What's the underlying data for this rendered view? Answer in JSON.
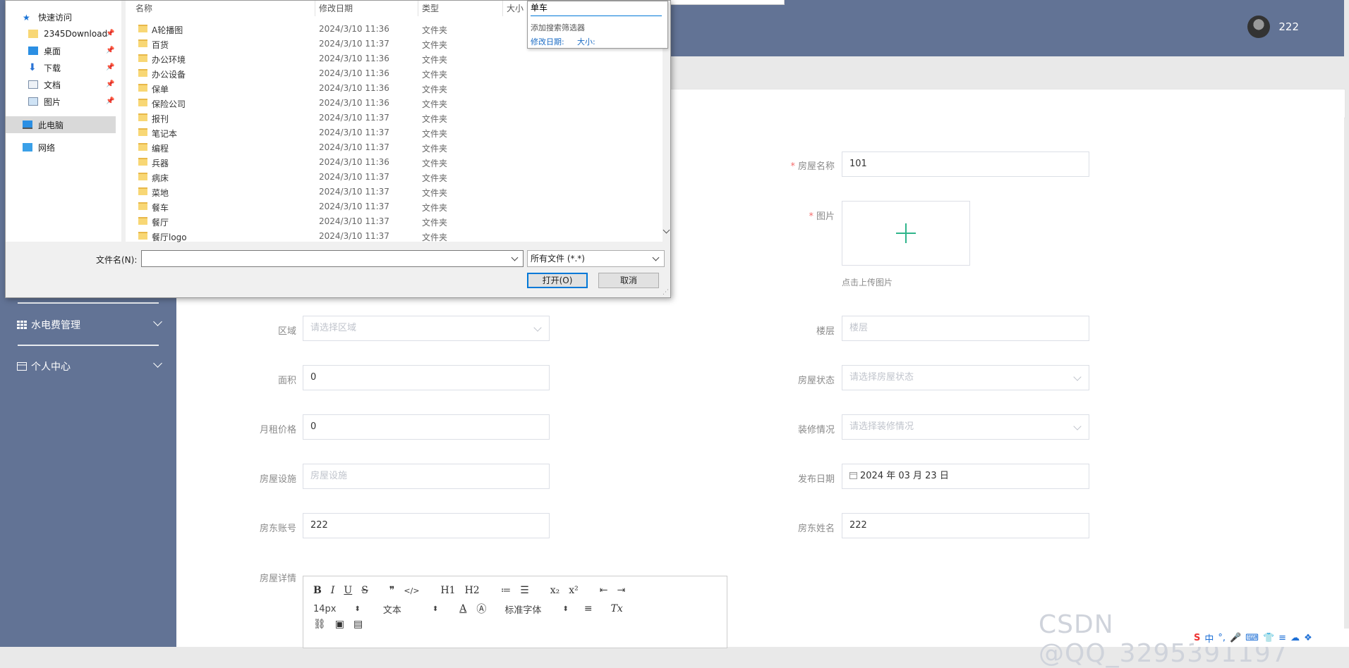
{
  "header": {
    "username": "222"
  },
  "sidebar": {
    "items": [
      {
        "label": "水电费管理"
      },
      {
        "label": "个人中心"
      }
    ]
  },
  "form": {
    "house_name": {
      "label": "房屋名称",
      "value": "101"
    },
    "image": {
      "label": "图片",
      "hint": "点击上传图片"
    },
    "region": {
      "label": "区域",
      "placeholder": "请选择区域"
    },
    "floor": {
      "label": "楼层",
      "placeholder": "楼层"
    },
    "area": {
      "label": "面积",
      "value": "0"
    },
    "house_status": {
      "label": "房屋状态",
      "placeholder": "请选择房屋状态"
    },
    "rent": {
      "label": "月租价格",
      "value": "0"
    },
    "decoration": {
      "label": "装修情况",
      "placeholder": "请选择装修情况"
    },
    "facilities": {
      "label": "房屋设施",
      "placeholder": "房屋设施"
    },
    "publish_date": {
      "label": "发布日期",
      "value": "2024 年 03 月 23 日"
    },
    "landlord_account": {
      "label": "房东账号",
      "value": "222"
    },
    "landlord_name": {
      "label": "房东姓名",
      "value": "222"
    },
    "details": {
      "label": "房屋详情"
    }
  },
  "editor": {
    "row1": [
      "B",
      "I",
      "U",
      "S",
      "❞",
      "</>",
      "H1",
      "H2",
      "≔",
      "☰",
      "x₂",
      "x²",
      "⇤",
      "⇥"
    ],
    "row2": {
      "size": "14px",
      "format": "文本",
      "font": "标准字体"
    },
    "row2_icons": [
      "A",
      "Ⓐ",
      "≡",
      "Tx"
    ],
    "row3": [
      "⛓",
      "▣",
      "▤"
    ]
  },
  "watermark": "CSDN @QQ_3295391197",
  "tray": [
    "中",
    "°,",
    "🎤",
    "⌨",
    "👕",
    "≡",
    "☁",
    "❖"
  ],
  "file_dialog": {
    "nav": {
      "quick_access": "快速访问",
      "items": [
        "2345Download",
        "桌面",
        "下载",
        "文档",
        "图片"
      ],
      "this_pc": "此电脑",
      "network": "网络"
    },
    "columns": {
      "name": "名称",
      "modified": "修改日期",
      "type": "类型",
      "size": "大小"
    },
    "rows": [
      {
        "name": "A轮播图",
        "date": "2024/3/10 11:36",
        "type": "文件夹"
      },
      {
        "name": "百货",
        "date": "2024/3/10 11:37",
        "type": "文件夹"
      },
      {
        "name": "办公环境",
        "date": "2024/3/10 11:36",
        "type": "文件夹"
      },
      {
        "name": "办公设备",
        "date": "2024/3/10 11:36",
        "type": "文件夹"
      },
      {
        "name": "保单",
        "date": "2024/3/10 11:36",
        "type": "文件夹"
      },
      {
        "name": "保险公司",
        "date": "2024/3/10 11:36",
        "type": "文件夹"
      },
      {
        "name": "报刊",
        "date": "2024/3/10 11:37",
        "type": "文件夹"
      },
      {
        "name": "笔记本",
        "date": "2024/3/10 11:37",
        "type": "文件夹"
      },
      {
        "name": "编程",
        "date": "2024/3/10 11:37",
        "type": "文件夹"
      },
      {
        "name": "兵器",
        "date": "2024/3/10 11:36",
        "type": "文件夹"
      },
      {
        "name": "病床",
        "date": "2024/3/10 11:37",
        "type": "文件夹"
      },
      {
        "name": "菜地",
        "date": "2024/3/10 11:37",
        "type": "文件夹"
      },
      {
        "name": "餐车",
        "date": "2024/3/10 11:37",
        "type": "文件夹"
      },
      {
        "name": "餐厅",
        "date": "2024/3/10 11:37",
        "type": "文件夹"
      },
      {
        "name": "餐厅logo",
        "date": "2024/3/10 11:37",
        "type": "文件夹"
      }
    ],
    "search": {
      "query": "单车",
      "add_filter": "添加搜索筛选器",
      "filter_date": "修改日期:",
      "filter_size": "大小:"
    },
    "filename_label": "文件名(N):",
    "filename_value": "",
    "filetype": "所有文件 (*.*)",
    "open_button": "打开(O)",
    "cancel_button": "取消"
  }
}
